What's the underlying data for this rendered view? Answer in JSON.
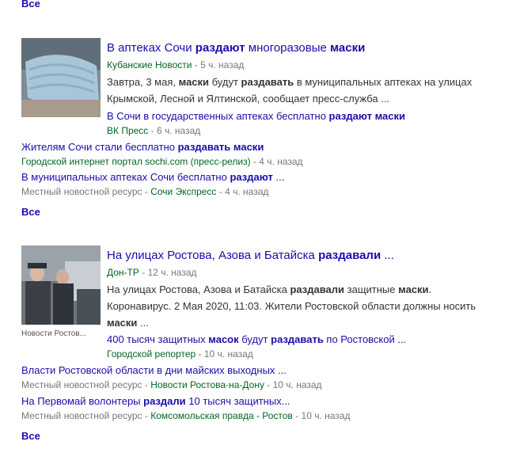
{
  "top_all": "Все",
  "stories": [
    {
      "thumb_alt": "маска",
      "headline": [
        [
          "В аптеках Сочи ",
          false
        ],
        [
          "раздают",
          true
        ],
        [
          " многоразовые ",
          false
        ],
        [
          "маски",
          true
        ]
      ],
      "source": "Кубанские Новости",
      "time": " - 5 ч. назад",
      "snippet": [
        [
          "Завтра, 3 мая, ",
          false
        ],
        [
          "маски",
          true
        ],
        [
          " будут ",
          false
        ],
        [
          "раздавать",
          true
        ],
        [
          " в муниципальных аптеках на улицах Крымской, Лесной и Ялтинской, сообщает пресс-служба ...",
          false
        ]
      ],
      "related": [
        {
          "title": [
            [
              "В Сочи в государственных аптеках бесплатно ",
              false
            ],
            [
              "раздают маски",
              true
            ]
          ],
          "source": "ВК Пресс",
          "prefix": "",
          "time": " - 6 ч. назад"
        },
        {
          "title": [
            [
              "Жителям Сочи стали бесплатно ",
              false
            ],
            [
              "раздавать маски",
              true
            ]
          ],
          "source": "Городской интернет портал sochi.com (пресс-релиз)",
          "prefix": "",
          "time": " - 4 ч. назад"
        },
        {
          "title": [
            [
              "В муниципальных аптеках Сочи бесплатно ",
              false
            ],
            [
              "раздают",
              true
            ],
            [
              " ...",
              false
            ]
          ],
          "source": "Сочи Экспресс",
          "prefix": "Местный новостной ресурс - ",
          "time": " - 4 ч. назад"
        }
      ],
      "all": "Все"
    },
    {
      "thumb_caption": "Новости Ростов...",
      "headline": [
        [
          "На улицах Ростова, Азова и Батайска ",
          false
        ],
        [
          "раздавали",
          true
        ],
        [
          " ...",
          false
        ]
      ],
      "source": "Дон-ТР",
      "time": " - 12 ч. назад",
      "snippet": [
        [
          "На улицах Ростова, Азова и Батайска ",
          false
        ],
        [
          "раздавали",
          true
        ],
        [
          " защитные ",
          false
        ],
        [
          "маски",
          true
        ],
        [
          ". Коронавирус. 2 Мая 2020, 11:03. Жители Ростовской области должны носить ",
          false
        ],
        [
          "маски",
          true
        ],
        [
          " ...",
          false
        ]
      ],
      "related": [
        {
          "title": [
            [
              "400 тысяч защитных ",
              false
            ],
            [
              "масок",
              true
            ],
            [
              " будут ",
              false
            ],
            [
              "раздавать",
              true
            ],
            [
              " по Ростовской ...",
              false
            ]
          ],
          "source": "Городской репортер",
          "prefix": "",
          "time": " - 10 ч. назад"
        },
        {
          "title": [
            [
              "Власти Ростовской области в дни майских выходных ...",
              false
            ]
          ],
          "source": "Новости Ростова-на-Дону",
          "prefix": "Местный новостной ресурс - ",
          "time": " - 10 ч. назад"
        },
        {
          "title": [
            [
              "На Первомай волонтеры ",
              false
            ],
            [
              "раздали",
              true
            ],
            [
              " 10 тысяч защитных...",
              false
            ]
          ],
          "source": "Комсомольская правда - Ростов",
          "prefix": "Местный новостной ресурс - ",
          "time": " - 10 ч. назад"
        }
      ],
      "all": "Все"
    }
  ],
  "colors": {
    "link": "#1a0dab",
    "source": "#006621",
    "muted": "#777777"
  }
}
